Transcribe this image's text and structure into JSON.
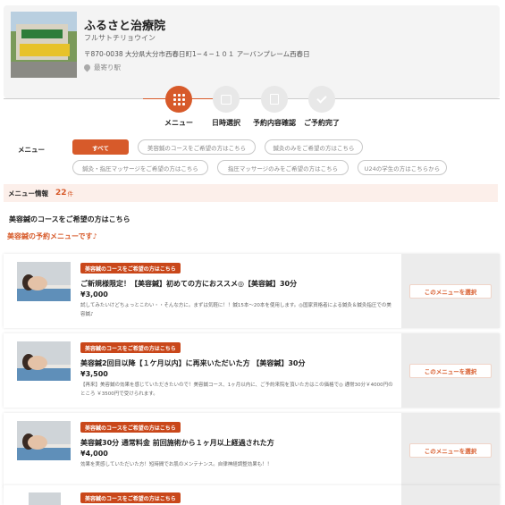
{
  "clinic": {
    "name": "ふるさと治療院",
    "kana": "フルサトチリョウイン",
    "address": "〒870-0038 大分県大分市西春日町1−４−１０１ アーバンプレーム西春日",
    "station": "最寄り駅"
  },
  "steps": [
    {
      "label": "メニュー",
      "icon": "grid-icon",
      "active": true
    },
    {
      "label": "日時選択",
      "icon": "calendar-icon",
      "active": false
    },
    {
      "label": "予約内容確認",
      "icon": "document-icon",
      "active": false
    },
    {
      "label": "ご予約完了",
      "icon": "check-icon",
      "active": false
    }
  ],
  "filter": {
    "label": "メニュー",
    "chips": [
      "すべて",
      "美容鍼のコースをご希望の方はこちら",
      "鍼灸のみをご希望の方はこちら",
      "鍼灸・指圧マッサージをご希望の方はこちら",
      "指圧マッサージのみをご希望の方はこちら",
      "U24の学生の方はこちらから"
    ]
  },
  "info": {
    "label": "メニュー情報",
    "count": "22",
    "unit": "件"
  },
  "section": {
    "title": "美容鍼のコースをご希望の方はこちら",
    "subtitle": "美容鍼の予約メニューです♪"
  },
  "menus": [
    {
      "tag": "美容鍼のコースをご希望の方はこちら",
      "name": "ご新規様限定！【美容鍼】初めての方におススメ◎【美容鍼】30分",
      "price": "¥3,000",
      "desc": "試してみたいけどちょっとこわい・・そんな方に。まずは気軽に！！鍼15本〜20本を使用します。◎国家資格者による鍼灸＆鍼灸指圧での美容鍼♪",
      "select": "このメニューを選択"
    },
    {
      "tag": "美容鍼のコースをご希望の方はこちら",
      "name": "美容鍼2回目以降【１ケ月以内】に再来いただいた方 【美容鍼】30分",
      "price": "¥3,500",
      "desc": "【再来】美容鍼の効果を感じていただきたいので！美容鍼コース、1ヶ月以内に、ご予約来院を頂いた方はこの価格で◎ 通常30分￥4000円のところ ￥3500円で受けられます。",
      "select": "このメニューを選択"
    },
    {
      "tag": "美容鍼のコースをご希望の方はこちら",
      "name": "美容鍼30分 通常料金 前回施術から１ヶ月以上経過された方",
      "price": "¥4,000",
      "desc": "効果を実感していただいた方！短時間でお肌のメンテナンス。自律神経調整効果も！！",
      "select": "このメニューを選択"
    },
    {
      "tag": "美容鍼のコースをご希望の方はこちら",
      "name": "",
      "price": "",
      "desc": "",
      "select": ""
    }
  ]
}
